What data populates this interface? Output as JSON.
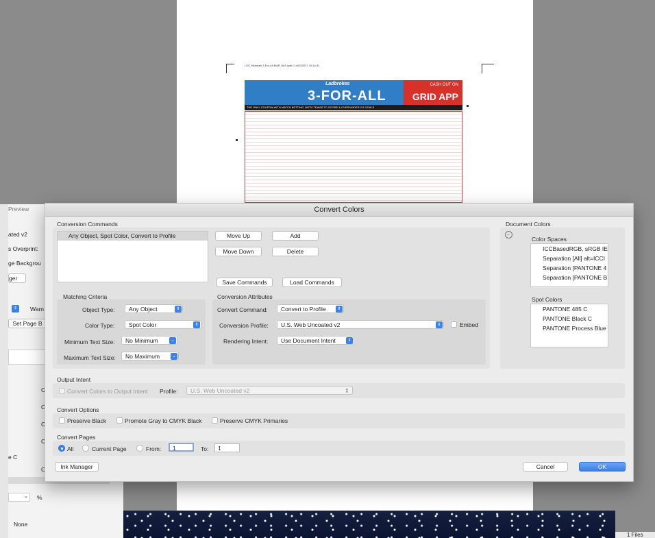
{
  "background": {
    "preview_tab": "Preview",
    "left_items": [
      "ated v2",
      "s Overprint:",
      "ge Backgrou",
      "ger",
      "Warn",
      "Set Page B",
      "C",
      "C",
      "C",
      "C",
      "e C",
      "C",
      "%",
      "None"
    ],
    "files_label": "1 Files"
  },
  "doc": {
    "header_line": "LOC Midweek 3-For-All MAR 18 A.qxdf  |  14/03/2017  10:14:31",
    "banner_top": "Ladbrokes",
    "banner_title": "3-FOR-ALL",
    "banner_cash": "CASH OUT ON",
    "banner_app": "GRID APP",
    "strip_text": "THE ONLY COUPON WITH MATCH BETTING, BOTH TEAMS TO SCORE & OVER/UNDER 2.5 GOALS"
  },
  "dialog": {
    "title": "Convert Colors",
    "conversion_commands_label": "Conversion Commands",
    "commands": [
      "Any Object, Spot Color, Convert to Profile"
    ],
    "buttons": {
      "move_up": "Move Up",
      "add": "Add",
      "move_down": "Move Down",
      "delete": "Delete",
      "save_commands": "Save Commands",
      "load_commands": "Load Commands",
      "ink_manager": "Ink Manager",
      "cancel": "Cancel",
      "ok": "OK"
    },
    "matching_criteria": {
      "label": "Matching Criteria",
      "object_type_label": "Object Type:",
      "object_type": "Any Object",
      "color_type_label": "Color Type:",
      "color_type": "Spot Color",
      "min_text_label": "Minimum Text Size:",
      "min_text": "No Minimum",
      "max_text_label": "Maximum Text Size:",
      "max_text": "No Maximum"
    },
    "conversion_attributes": {
      "label": "Conversion Attributes",
      "command_label": "Convert Command:",
      "command": "Convert to Profile",
      "profile_label": "Conversion Profile:",
      "profile": "U.S. Web Uncoated v2",
      "embed_label": "Embed",
      "intent_label": "Rendering Intent:",
      "intent": "Use Document Intent"
    },
    "document_colors": {
      "label": "Document Colors",
      "color_spaces_label": "Color Spaces",
      "color_spaces": [
        "ICCBasedRGB, sRGB IEC",
        "Separation [All] alt=ICCI",
        "Separation [PANTONE 4",
        "Separation [PANTONE B"
      ],
      "spot_colors_label": "Spot Colors",
      "spot_colors": [
        "PANTONE 485 C",
        "PANTONE Black C",
        "PANTONE Process Blue"
      ]
    },
    "output_intent": {
      "label": "Output Intent",
      "convert_label": "Convert Colors to Output Intent",
      "profile_label": "Profile:",
      "profile": "U.S. Web Uncoated v2"
    },
    "convert_options": {
      "label": "Convert Options",
      "preserve_black": "Preserve Black",
      "promote_gray": "Promote Gray to CMYK Black",
      "preserve_cmyk": "Preserve CMYK Primaries"
    },
    "convert_pages": {
      "label": "Convert Pages",
      "all": "All",
      "current": "Current Page",
      "from_label": "From:",
      "from": "1",
      "to_label": "To:",
      "to": "1"
    }
  }
}
